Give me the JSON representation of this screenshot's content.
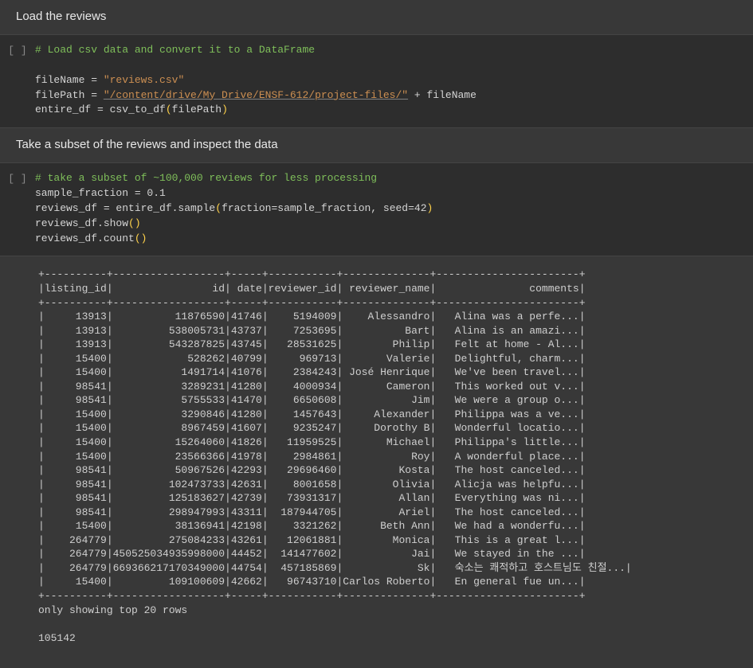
{
  "section1": {
    "heading": "Load the reviews"
  },
  "cell1": {
    "exec_label": "[ ]",
    "comment": "# Load csv data and convert it to a DataFrame",
    "l1_var": "fileName",
    "l1_eq": " = ",
    "l1_str": "\"reviews.csv\"",
    "l2_var": "filePath",
    "l2_eq": " = ",
    "l2_str": "\"/content/drive/My Drive/ENSF-612/project-files/\"",
    "l2_plus": " + ",
    "l2_suffix": "fileName",
    "l3_var": "entire_df",
    "l3_eq": " = ",
    "l3_call_a": "csv_to_df",
    "l3_open": "(",
    "l3_arg": "filePath",
    "l3_close": ")"
  },
  "section2": {
    "heading": "Take a subset of the reviews and inspect the data"
  },
  "cell2": {
    "exec_label": "[ ]",
    "comment": "# take a subset of ~100,000 reviews for less processing",
    "l1": "sample_fraction = 0.1",
    "l2a": "reviews_df = entire_df.sample",
    "l2b": "(",
    "l2c": "fraction=sample_fraction, seed=42",
    "l2d": ")",
    "l3a": "reviews_df.show",
    "l3b": "(",
    "l3c": ")",
    "l4a": "reviews_df.count",
    "l4b": "(",
    "l4c": ")"
  },
  "output": {
    "columns": [
      "listing_id",
      "id",
      "date",
      "reviewer_id",
      "reviewer_name",
      "comments"
    ],
    "rows": [
      [
        "13913",
        "11876590",
        "41746",
        "5194009",
        "Alessandro",
        "Alina was a perfe..."
      ],
      [
        "13913",
        "538005731",
        "43737",
        "7253695",
        "Bart",
        "Alina is an amazi..."
      ],
      [
        "13913",
        "543287825",
        "43745",
        "28531625",
        "Philip",
        "Felt at home - Al..."
      ],
      [
        "15400",
        "528262",
        "40799",
        "969713",
        "Valerie",
        "Delightful, charm..."
      ],
      [
        "15400",
        "1491714",
        "41076",
        "2384243",
        "José Henrique",
        "We've been travel..."
      ],
      [
        "98541",
        "3289231",
        "41280",
        "4000934",
        "Cameron",
        "This worked out v..."
      ],
      [
        "98541",
        "5755533",
        "41470",
        "6650608",
        "Jim",
        "We were a group o..."
      ],
      [
        "15400",
        "3290846",
        "41280",
        "1457643",
        "Alexander",
        "Philippa was a ve..."
      ],
      [
        "15400",
        "8967459",
        "41607",
        "9235247",
        "Dorothy B",
        "Wonderful locatio..."
      ],
      [
        "15400",
        "15264060",
        "41826",
        "11959525",
        "Michael",
        "Philippa's little..."
      ],
      [
        "15400",
        "23566366",
        "41978",
        "2984861",
        "Roy",
        "A wonderful place..."
      ],
      [
        "98541",
        "50967526",
        "42293",
        "29696460",
        "Kosta",
        "The host canceled..."
      ],
      [
        "98541",
        "102473733",
        "42631",
        "8001658",
        "Olivia",
        "Alicja was helpfu..."
      ],
      [
        "98541",
        "125183627",
        "42739",
        "73931317",
        "Allan",
        "Everything was ni..."
      ],
      [
        "98541",
        "298947993",
        "43311",
        "187944705",
        "Ariel",
        "The host canceled..."
      ],
      [
        "15400",
        "38136941",
        "42198",
        "3321262",
        "Beth Ann",
        "We had a wonderfu..."
      ],
      [
        "264779",
        "275084233",
        "43261",
        "12061881",
        "Monica",
        "This is a great l..."
      ],
      [
        "264779",
        "450525034935998000",
        "44452",
        "141477602",
        "Jai",
        "We stayed in the ..."
      ],
      [
        "264779",
        "669366217170349000",
        "44754",
        "457185869",
        "Sk",
        "숙소는 쾌적하고 호스트님도 친절..."
      ],
      [
        "15400",
        "109100609",
        "42662",
        "96743710",
        "Carlos Roberto",
        "En general fue un..."
      ]
    ],
    "footer1": "only showing top 20 rows",
    "count": "105142",
    "widths": [
      10,
      18,
      5,
      11,
      14,
      23
    ]
  }
}
